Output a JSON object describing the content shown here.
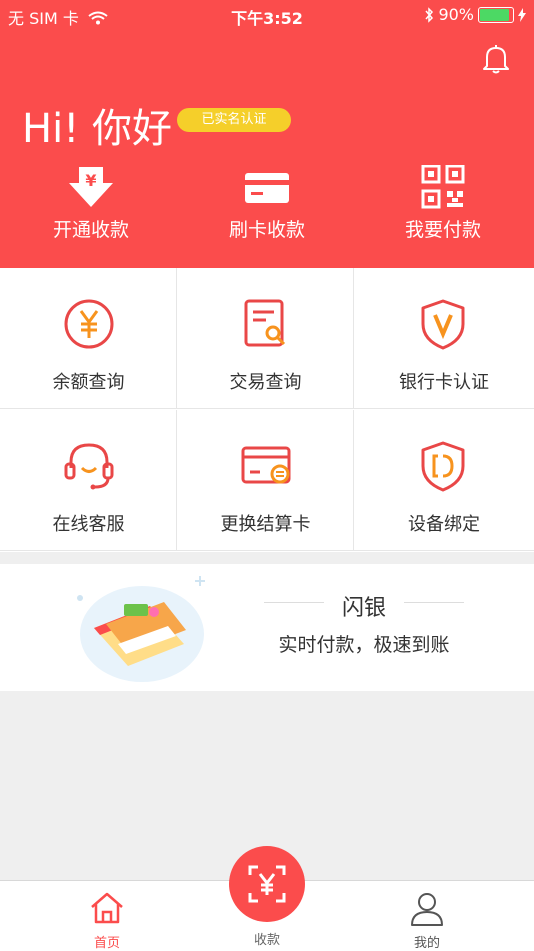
{
  "status_bar": {
    "carrier": "无 SIM 卡",
    "time": "下午3:52",
    "battery": "90%"
  },
  "header": {
    "greeting": "Hi! 你好",
    "verified_badge": "已实名认证",
    "actions": [
      {
        "label": "开通收款",
        "icon": "yen-download-icon"
      },
      {
        "label": "刷卡收款",
        "icon": "card-icon"
      },
      {
        "label": "我要付款",
        "icon": "qr-code-icon"
      }
    ]
  },
  "services": [
    {
      "label": "余额查询",
      "icon": "yen-circle-icon"
    },
    {
      "label": "交易查询",
      "icon": "document-search-icon"
    },
    {
      "label": "银行卡认证",
      "icon": "shield-v-icon"
    },
    {
      "label": "在线客服",
      "icon": "headset-icon"
    },
    {
      "label": "更换结算卡",
      "icon": "card-swap-icon"
    },
    {
      "label": "设备绑定",
      "icon": "shield-d-icon"
    }
  ],
  "banner": {
    "title": "闪银",
    "subtitle": "实时付款，极速到账"
  },
  "tabbar": {
    "home": "首页",
    "collect": "收款",
    "mine": "我的"
  },
  "colors": {
    "brand": "#fb4c4c",
    "badge": "#f5cf2a",
    "icon_orange": "#f7931e"
  }
}
